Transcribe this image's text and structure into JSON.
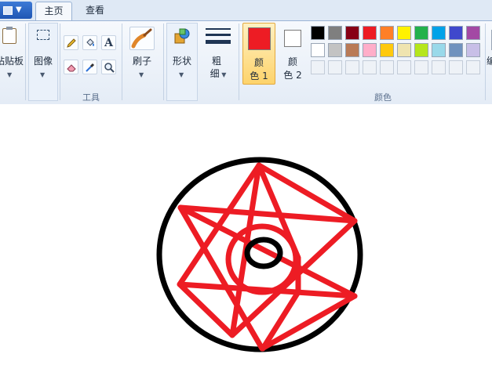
{
  "tabs": {
    "home": "主页",
    "view": "查看"
  },
  "groups": {
    "clipboard": {
      "paste_label": "粘贴板"
    },
    "image": {
      "label": "图像"
    },
    "tools": {
      "label": "工具",
      "text_glyph": "A"
    },
    "brushes": {
      "label": "刷子"
    },
    "shapes": {
      "label": "形状"
    },
    "size": {
      "line1": "粗",
      "line2": "细"
    },
    "colors": {
      "label": "颜色",
      "color1": {
        "line1": "颜",
        "line2": "色 1",
        "value": "#ed1c24"
      },
      "color2": {
        "line1": "颜",
        "line2": "色 2",
        "value": "#ffffff"
      },
      "edit_label": "编",
      "palette_row1": [
        "#000000",
        "#7f7f7f",
        "#880015",
        "#ed1c24",
        "#ff7f27",
        "#fff200",
        "#22b14c",
        "#00a2e8",
        "#3f48cc",
        "#a349a4"
      ],
      "palette_row2": [
        "#ffffff",
        "#c3c3c3",
        "#b97a57",
        "#ffaec9",
        "#ffc90e",
        "#efe4b0",
        "#b5e61d",
        "#99d9ea",
        "#7092be",
        "#c8bfe7"
      ]
    }
  },
  "icons": {
    "file_menu": "file-menu-icon",
    "paste": "clipboard-icon",
    "select": "select-icon",
    "pencil": "pencil-icon",
    "fill": "fill-bucket-icon",
    "text": "text-icon",
    "eraser": "eraser-icon",
    "picker": "color-picker-icon",
    "magnifier": "magnifier-icon",
    "brush": "brush-icon",
    "shapes": "shapes-icon",
    "size": "line-size-icon"
  },
  "drawing": {
    "circle_color": "#000000",
    "star_color": "#ed1c24"
  }
}
